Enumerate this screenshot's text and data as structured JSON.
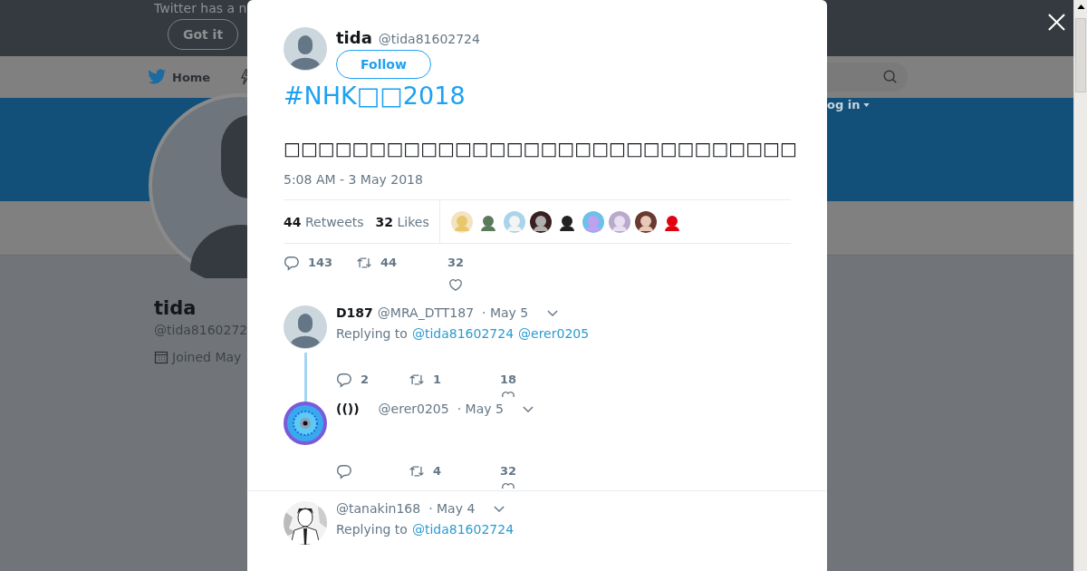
{
  "background_page": {
    "notice": {
      "text": "Twitter has a n",
      "button": "Got it"
    },
    "nav": {
      "home": "Home",
      "login": "og in"
    },
    "profile": {
      "name": "tida",
      "handle": "@tida8160272",
      "joined": "Joined May"
    }
  },
  "modal": {
    "author": {
      "name": "tida",
      "handle": "@tida81602724",
      "follow": "Follow",
      "avatar": {
        "kind": "default"
      }
    },
    "hashtag": "#NHK□□2018",
    "text": "□□□□□□□□□□□□□□□□□□□□□□□□□□□□□□",
    "timestamp": "5:08 AM - 3 May 2018",
    "stats": [
      {
        "count": "44",
        "label": "Retweets"
      },
      {
        "count": "32",
        "label": "Likes"
      }
    ],
    "liker_avatars": [
      {
        "kind": "picture"
      },
      {
        "kind": "picture"
      },
      {
        "kind": "picture"
      },
      {
        "kind": "picture"
      },
      {
        "kind": "picture"
      },
      {
        "kind": "picture"
      },
      {
        "kind": "picture"
      },
      {
        "kind": "picture"
      },
      {
        "kind": "picture"
      }
    ],
    "actions": [
      {
        "kind": "reply",
        "count": "143"
      },
      {
        "kind": "retweet",
        "count": "44"
      },
      {
        "kind": "like",
        "count": "32"
      }
    ],
    "replies": [
      {
        "name": "D187",
        "handle": "@MRA_DTT187",
        "date": "· May 5",
        "avatar": {
          "kind": "default"
        },
        "replying_label": "Replying to",
        "mentions": [
          "@tida81602724",
          "@erer0205"
        ],
        "thread_line": true,
        "actions": [
          {
            "kind": "reply",
            "count": "2"
          },
          {
            "kind": "retweet",
            "count": "1"
          },
          {
            "kind": "like",
            "count": "18"
          }
        ]
      },
      {
        "name": "(())",
        "handle": "@erer0205",
        "date": "· May 5",
        "avatar": {
          "kind": "pattern"
        },
        "thread_line": false,
        "actions": [
          {
            "kind": "reply"
          },
          {
            "kind": "retweet",
            "count": "4"
          },
          {
            "kind": "like",
            "count": "32"
          }
        ]
      },
      {
        "handle": "@tanakin168",
        "date": "· May 4",
        "avatar": {
          "kind": "picture"
        },
        "replying_label": "Replying to",
        "mentions": [
          "@tida81602724"
        ],
        "thread_line": false
      }
    ]
  }
}
